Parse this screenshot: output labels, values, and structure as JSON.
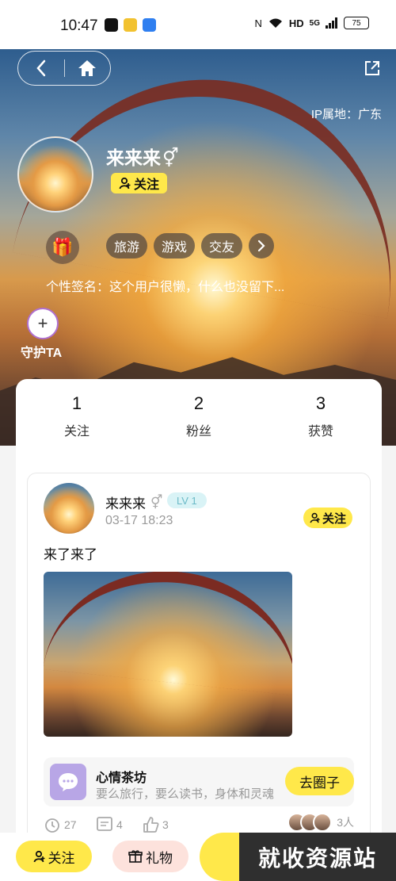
{
  "status_bar": {
    "time": "10:47",
    "network": "5G",
    "hd": "HD",
    "battery": "75"
  },
  "profile": {
    "ip_location": "IP属地：广东",
    "username": "来来来",
    "gender_symbol": "⚥",
    "follow_label": "关注",
    "tags": [
      "旅游",
      "游戏",
      "交友"
    ],
    "signature": "个性签名：这个用户很懒，什么也没留下...",
    "guard_label": "守护TA"
  },
  "stats": [
    {
      "value": "1",
      "label": "关注"
    },
    {
      "value": "2",
      "label": "粉丝"
    },
    {
      "value": "3",
      "label": "获赞"
    }
  ],
  "post": {
    "author": "来来来",
    "gender_symbol": "⚥",
    "level": "LV 1",
    "time": "03-17 18:23",
    "follow_label": "关注",
    "text": "来了来了",
    "circle": {
      "name": "心情茶坊",
      "description": "要么旅行，要么读书，身体和灵魂",
      "button": "去圈子"
    },
    "actions": {
      "views": "27",
      "comments": "4",
      "likes": "3"
    },
    "participants": "3人"
  },
  "bottom_bar": {
    "follow_label": "关注",
    "gift_label": "礼物"
  },
  "watermark": "就收资源站",
  "colors": {
    "accent_yellow": "#ffe84a",
    "level_badge": "#d9f3f6",
    "circle_icon": "#b8a6e6",
    "gift_button": "#fde2dc"
  }
}
